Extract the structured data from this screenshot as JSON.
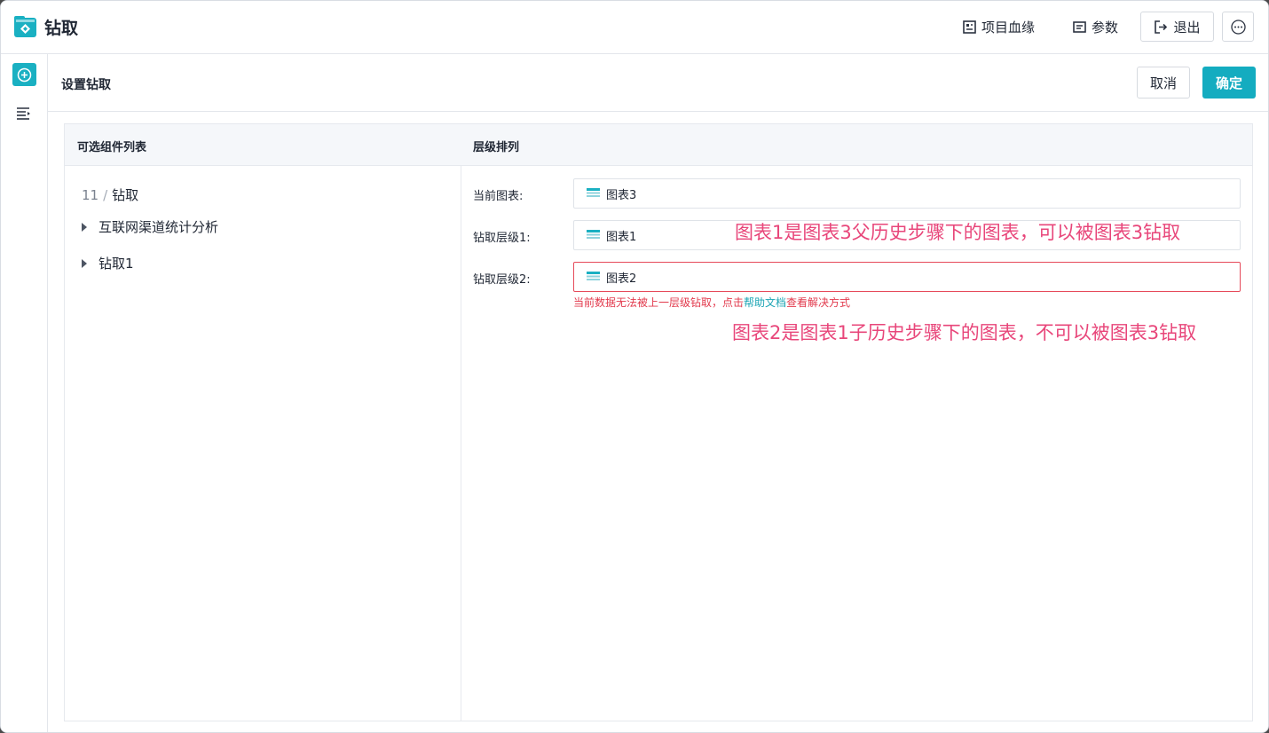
{
  "app": {
    "title": "钻取",
    "brand_color": "#14acc0"
  },
  "toolbar": {
    "lineage_label": "项目血缘",
    "params_label": "参数",
    "exit_label": "退出"
  },
  "drill_setting": {
    "title": "设置钻取",
    "cancel_label": "取消",
    "ok_label": "确定"
  },
  "left_panel": {
    "header": "可选组件列表",
    "breadcrumb": {
      "id": "11",
      "separator": "/",
      "name": "钻取"
    },
    "tree": [
      {
        "label": "互联网渠道统计分析"
      },
      {
        "label": "钻取1"
      }
    ]
  },
  "right_panel": {
    "header": "层级排列",
    "rows": [
      {
        "label": "当前图表:",
        "value": "图表3"
      },
      {
        "label": "钻取层级1:",
        "value": "图表1"
      },
      {
        "label": "钻取层级2:",
        "value": "图表2"
      }
    ],
    "error": {
      "prefix": "当前数据无法被上一层级钻取，点击",
      "link": "帮助文档",
      "suffix": "查看解决方式"
    }
  },
  "annotations": {
    "note1": "图表1是图表3父历史步骤下的图表，可以被图表3钻取",
    "note2": "图表2是图表1子历史步骤下的图表，不可以被图表3钻取",
    "color": "#e8467a"
  }
}
